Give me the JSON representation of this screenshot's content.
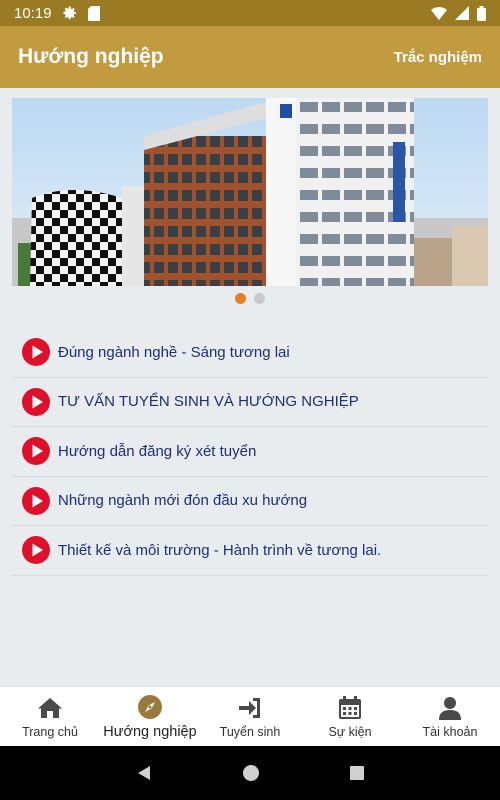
{
  "status_bar": {
    "time": "10:19"
  },
  "app_bar": {
    "title": "Hướng nghiệp",
    "action_label": "Trắc nghiệm"
  },
  "carousel": {
    "slide_count": 2,
    "active_index": 0
  },
  "videos": [
    {
      "label": "Đúng ngành nghề - Sáng tương lai",
      "icon": "play-icon"
    },
    {
      "label": "TƯ VẤN TUYỂN SINH VÀ HƯỚNG NGHIỆP",
      "icon": "play-icon"
    },
    {
      "label": "Hướng dẫn đăng ký xét tuyển",
      "icon": "play-icon"
    },
    {
      "label": "Những ngành mới đón đầu xu hướng",
      "icon": "play-icon"
    },
    {
      "label": "Thiết kế và môi trường - Hành trình về tương lai.",
      "icon": "play-icon"
    }
  ],
  "bottom_nav": [
    {
      "label": "Trang chủ",
      "icon": "home-icon"
    },
    {
      "label": "Hướng nghiệp",
      "icon": "compass-icon",
      "active": true
    },
    {
      "label": "Tuyển sinh",
      "icon": "sign-in-icon"
    },
    {
      "label": "Sự kiện",
      "icon": "calendar-icon"
    },
    {
      "label": "Tài khoản",
      "icon": "user-icon"
    }
  ],
  "colors": {
    "app_bar": "#c29a3f",
    "status_bar": "#9a7a23",
    "accent": "#e67e22",
    "play": "#e0102a",
    "link_text": "#1c2e7a"
  }
}
